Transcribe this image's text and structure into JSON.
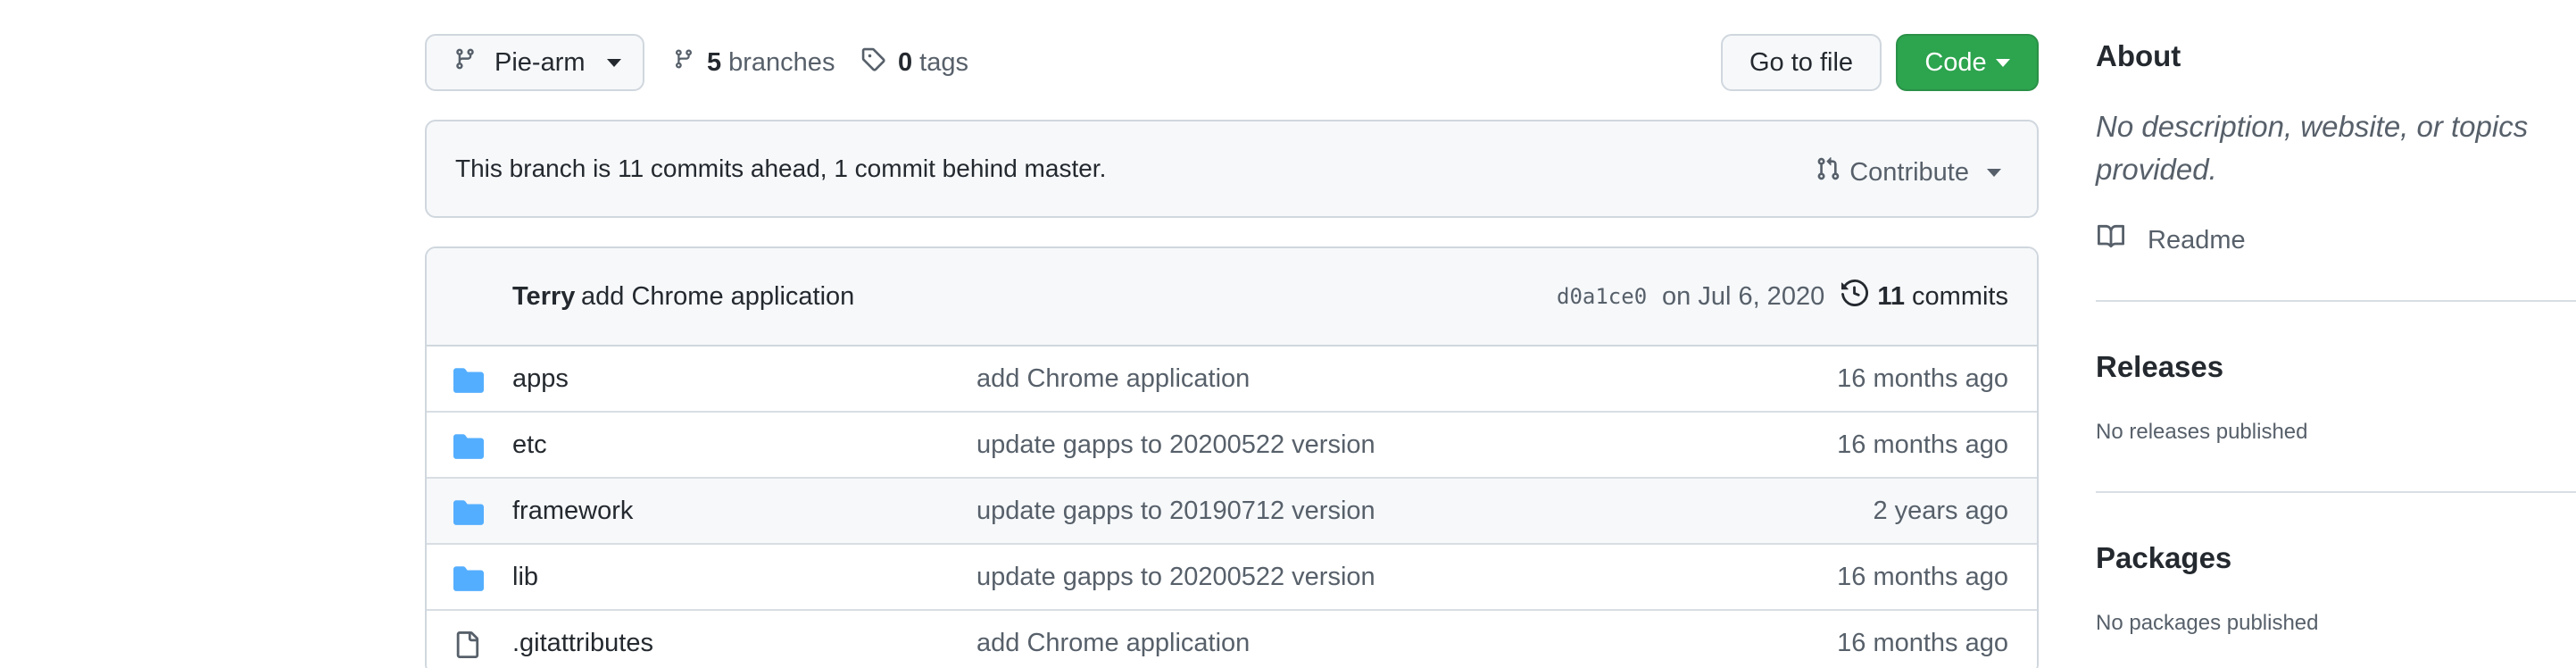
{
  "toolbar": {
    "branch_label": "Pie-arm",
    "branches_count": "5",
    "branches_label": "branches",
    "tags_count": "0",
    "tags_label": "tags",
    "goto_file_label": "Go to file",
    "code_label": "Code"
  },
  "banner": {
    "message": "This branch is 11 commits ahead, 1 commit behind master.",
    "contribute_label": "Contribute"
  },
  "latest_commit": {
    "author": "Terry",
    "message": "add Chrome application",
    "sha": "d0a1ce0",
    "date": "on Jul 6, 2020",
    "commits_count": "11",
    "commits_label": "commits"
  },
  "files": [
    {
      "type": "folder",
      "name": "apps",
      "message": "add Chrome application",
      "age": "16 months ago"
    },
    {
      "type": "folder",
      "name": "etc",
      "message": "update gapps to 20200522 version",
      "age": "16 months ago"
    },
    {
      "type": "folder",
      "name": "framework",
      "message": "update gapps to 20190712 version",
      "age": "2 years ago"
    },
    {
      "type": "folder",
      "name": "lib",
      "message": "update gapps to 20200522 version",
      "age": "16 months ago"
    },
    {
      "type": "file",
      "name": ".gitattributes",
      "message": "add Chrome application",
      "age": "16 months ago"
    }
  ],
  "sidebar": {
    "about_heading": "About",
    "about_description": "No description, website, or topics provided.",
    "readme_label": "Readme",
    "releases_heading": "Releases",
    "releases_note": "No releases published",
    "packages_heading": "Packages",
    "packages_note": "No packages published"
  },
  "colors": {
    "code_button": "#2da44e",
    "folder_icon": "#54aeff",
    "muted_text": "#57606a",
    "border": "#d0d7de"
  },
  "icons": [
    "git-branch-icon",
    "tag-icon",
    "git-pull-request-icon",
    "history-icon",
    "folder-icon",
    "file-icon",
    "book-icon",
    "chevron-down-icon"
  ]
}
